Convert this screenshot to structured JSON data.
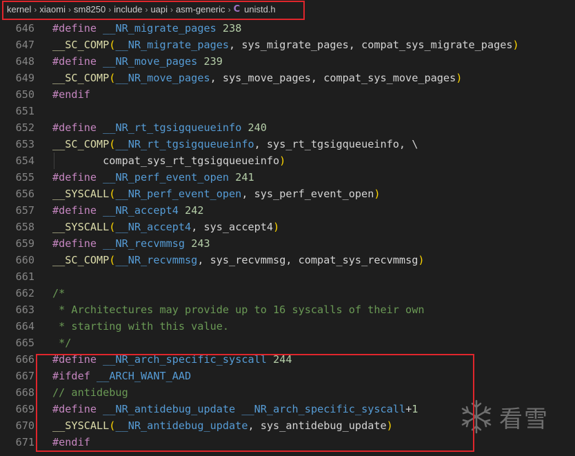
{
  "breadcrumb": {
    "items": [
      "kernel",
      "xiaomi",
      "sm8250",
      "include",
      "uapi",
      "asm-generic"
    ],
    "file": "unistd.h",
    "file_icon": "C"
  },
  "watermark": {
    "text": "看雪"
  },
  "colors": {
    "background": "#1e1e1e",
    "highlight_box": "#e0262c",
    "macro": "#569cd6",
    "preprocessor": "#c586c0",
    "number": "#b5cea8",
    "function": "#dcdcaa",
    "comment": "#6a9955"
  },
  "lines": [
    {
      "n": "646",
      "tokens": [
        [
          "k",
          "#define"
        ],
        [
          "t",
          " "
        ],
        [
          "m",
          "__NR_migrate_pages"
        ],
        [
          "t",
          " "
        ],
        [
          "n",
          "238"
        ]
      ]
    },
    {
      "n": "647",
      "tokens": [
        [
          "f",
          "__SC_COMP"
        ],
        [
          "p",
          "("
        ],
        [
          "m",
          "__NR_migrate_pages"
        ],
        [
          "t",
          ", sys_migrate_pages, compat_sys_migrate_pages"
        ],
        [
          "p",
          ")"
        ]
      ]
    },
    {
      "n": "648",
      "tokens": [
        [
          "k",
          "#define"
        ],
        [
          "t",
          " "
        ],
        [
          "m",
          "__NR_move_pages"
        ],
        [
          "t",
          " "
        ],
        [
          "n",
          "239"
        ]
      ]
    },
    {
      "n": "649",
      "tokens": [
        [
          "f",
          "__SC_COMP"
        ],
        [
          "p",
          "("
        ],
        [
          "m",
          "__NR_move_pages"
        ],
        [
          "t",
          ", sys_move_pages, compat_sys_move_pages"
        ],
        [
          "p",
          ")"
        ]
      ]
    },
    {
      "n": "650",
      "tokens": [
        [
          "k",
          "#endif"
        ]
      ]
    },
    {
      "n": "651",
      "tokens": []
    },
    {
      "n": "652",
      "tokens": [
        [
          "k",
          "#define"
        ],
        [
          "t",
          " "
        ],
        [
          "m",
          "__NR_rt_tgsigqueueinfo"
        ],
        [
          "t",
          " "
        ],
        [
          "n",
          "240"
        ]
      ]
    },
    {
      "n": "653",
      "tokens": [
        [
          "f",
          "__SC_COMP"
        ],
        [
          "p",
          "("
        ],
        [
          "m",
          "__NR_rt_tgsigqueueinfo"
        ],
        [
          "t",
          ", sys_rt_tgsigqueueinfo, \\"
        ]
      ]
    },
    {
      "n": "654",
      "guide": true,
      "tokens": [
        [
          "t",
          "        compat_sys_rt_tgsigqueueinfo"
        ],
        [
          "p",
          ")"
        ]
      ]
    },
    {
      "n": "655",
      "tokens": [
        [
          "k",
          "#define"
        ],
        [
          "t",
          " "
        ],
        [
          "m",
          "__NR_perf_event_open"
        ],
        [
          "t",
          " "
        ],
        [
          "n",
          "241"
        ]
      ]
    },
    {
      "n": "656",
      "tokens": [
        [
          "f",
          "__SYSCALL"
        ],
        [
          "p",
          "("
        ],
        [
          "m",
          "__NR_perf_event_open"
        ],
        [
          "t",
          ", sys_perf_event_open"
        ],
        [
          "p",
          ")"
        ]
      ]
    },
    {
      "n": "657",
      "tokens": [
        [
          "k",
          "#define"
        ],
        [
          "t",
          " "
        ],
        [
          "m",
          "__NR_accept4"
        ],
        [
          "t",
          " "
        ],
        [
          "n",
          "242"
        ]
      ]
    },
    {
      "n": "658",
      "tokens": [
        [
          "f",
          "__SYSCALL"
        ],
        [
          "p",
          "("
        ],
        [
          "m",
          "__NR_accept4"
        ],
        [
          "t",
          ", sys_accept4"
        ],
        [
          "p",
          ")"
        ]
      ]
    },
    {
      "n": "659",
      "tokens": [
        [
          "k",
          "#define"
        ],
        [
          "t",
          " "
        ],
        [
          "m",
          "__NR_recvmmsg"
        ],
        [
          "t",
          " "
        ],
        [
          "n",
          "243"
        ]
      ]
    },
    {
      "n": "660",
      "tokens": [
        [
          "f",
          "__SC_COMP"
        ],
        [
          "p",
          "("
        ],
        [
          "m",
          "__NR_recvmmsg"
        ],
        [
          "t",
          ", sys_recvmmsg, compat_sys_recvmmsg"
        ],
        [
          "p",
          ")"
        ]
      ]
    },
    {
      "n": "661",
      "tokens": []
    },
    {
      "n": "662",
      "tokens": [
        [
          "c",
          "/*"
        ]
      ]
    },
    {
      "n": "663",
      "tokens": [
        [
          "c",
          " * Architectures may provide up to 16 syscalls of their own"
        ]
      ]
    },
    {
      "n": "664",
      "tokens": [
        [
          "c",
          " * starting with this value."
        ]
      ]
    },
    {
      "n": "665",
      "tokens": [
        [
          "c",
          " */"
        ]
      ]
    },
    {
      "n": "666",
      "tokens": [
        [
          "k",
          "#define"
        ],
        [
          "t",
          " "
        ],
        [
          "m",
          "__NR_arch_specific_syscall"
        ],
        [
          "t",
          " "
        ],
        [
          "n",
          "244"
        ]
      ]
    },
    {
      "n": "667",
      "tokens": [
        [
          "k",
          "#ifdef"
        ],
        [
          "t",
          " "
        ],
        [
          "m",
          "__ARCH_WANT_AAD"
        ]
      ]
    },
    {
      "n": "668",
      "tokens": [
        [
          "c",
          "// antidebug"
        ]
      ]
    },
    {
      "n": "669",
      "tokens": [
        [
          "k",
          "#define"
        ],
        [
          "t",
          " "
        ],
        [
          "m",
          "__NR_antidebug_update"
        ],
        [
          "t",
          " "
        ],
        [
          "m",
          "__NR_arch_specific_syscall"
        ],
        [
          "t",
          "+"
        ],
        [
          "n",
          "1"
        ]
      ]
    },
    {
      "n": "670",
      "tokens": [
        [
          "f",
          "__SYSCALL"
        ],
        [
          "p",
          "("
        ],
        [
          "m",
          "__NR_antidebug_update"
        ],
        [
          "t",
          ", sys_antidebug_update"
        ],
        [
          "p",
          ")"
        ]
      ]
    },
    {
      "n": "671",
      "tokens": [
        [
          "k",
          "#endif"
        ]
      ]
    }
  ]
}
